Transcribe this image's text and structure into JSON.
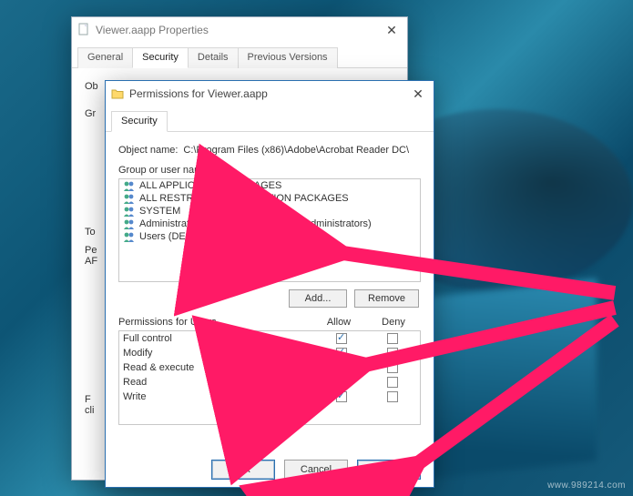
{
  "watermark": "www.989214.com",
  "properties_window": {
    "title": "Viewer.aapp Properties",
    "tabs": [
      "General",
      "Security",
      "Details",
      "Previous Versions"
    ],
    "active_tab": 1,
    "partial_labels": {
      "object_prefix": "Ob",
      "group_prefix": "Gr",
      "to_prefix": "To",
      "pe_prefix": "Pe",
      "af_prefix": "AF",
      "f_prefix": "F",
      "cl_prefix": "cli"
    }
  },
  "permissions_window": {
    "title": "Permissions for Viewer.aapp",
    "tab": "Security",
    "object_name_label": "Object name:",
    "object_name_value": "C:\\Program Files (x86)\\Adobe\\Acrobat Reader DC\\",
    "group_label": "Group or user names:",
    "groups": [
      {
        "label": "ALL APPLICATION PACKAGES",
        "icon": "group"
      },
      {
        "label": "ALL RESTRICTED APPLICATION PACKAGES",
        "icon": "group"
      },
      {
        "label": "SYSTEM",
        "icon": "group"
      },
      {
        "label": "Administrators (DESKTOP-DUI97JC\\Administrators)",
        "icon": "group"
      },
      {
        "label": "Users (DESKTOP-DUI97JC\\Users)",
        "icon": "group"
      }
    ],
    "add_button": "Add...",
    "remove_button": "Remove",
    "perm_header": "Permissions for Users",
    "allow_col": "Allow",
    "deny_col": "Deny",
    "permissions": [
      {
        "name": "Full control",
        "allow": true,
        "deny": false
      },
      {
        "name": "Modify",
        "allow": true,
        "deny": false
      },
      {
        "name": "Read & execute",
        "allow": true,
        "deny": false
      },
      {
        "name": "Read",
        "allow": true,
        "deny": false
      },
      {
        "name": "Write",
        "allow": true,
        "deny": false
      }
    ],
    "ok_button": "OK",
    "cancel_button": "Cancel",
    "apply_button": "Apply"
  }
}
